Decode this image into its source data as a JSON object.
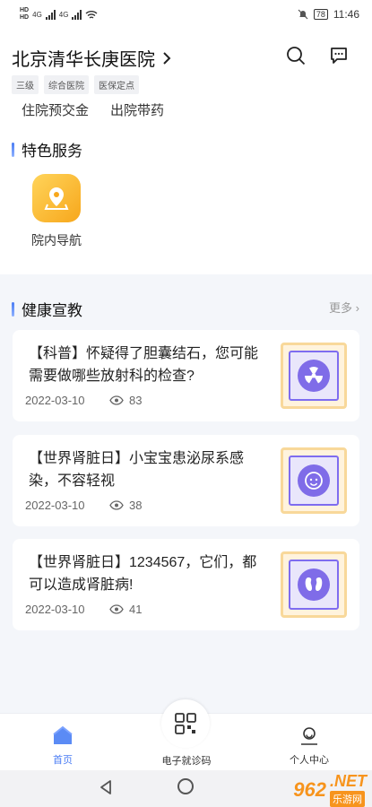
{
  "status_bar": {
    "sim1": "HD\n1",
    "sim2": "HD\n2",
    "net1": "4G",
    "net2": "4G",
    "battery": "78",
    "time": "11:46"
  },
  "header": {
    "hospital_name": "北京清华长庚医院",
    "tags": [
      "三级",
      "综合医院",
      "医保定点"
    ],
    "links": [
      "住院预交金",
      "出院带药"
    ]
  },
  "special_services": {
    "title": "特色服务",
    "items": [
      {
        "label": "院内导航",
        "icon": "location-pin-icon"
      }
    ]
  },
  "health_education": {
    "title": "健康宣教",
    "more_label": "更多",
    "articles": [
      {
        "title": "【科普】怀疑得了胆囊结石，您可能需要做哪些放射科的检查?",
        "date": "2022-03-10",
        "views": "83",
        "thumb_icon": "radiation-icon"
      },
      {
        "title": "【世界肾脏日】小宝宝患泌尿系感染，不容轻视",
        "date": "2022-03-10",
        "views": "38",
        "thumb_icon": "baby-face-icon"
      },
      {
        "title": "【世界肾脏日】1234567，它们，都可以造成肾脏病!",
        "date": "2022-03-10",
        "views": "41",
        "thumb_icon": "kidney-icon"
      }
    ]
  },
  "tab_bar": {
    "home": "首页",
    "center": "电子就诊码",
    "profile": "个人中心"
  },
  "watermark": {
    "num": "962",
    "net": ".NET",
    "cn": "乐游网"
  },
  "colors": {
    "accent": "#4a7cf4",
    "nav_tile": "#f7a71c",
    "thumb_purple": "#7f6ce8",
    "watermark": "#f7941d"
  }
}
